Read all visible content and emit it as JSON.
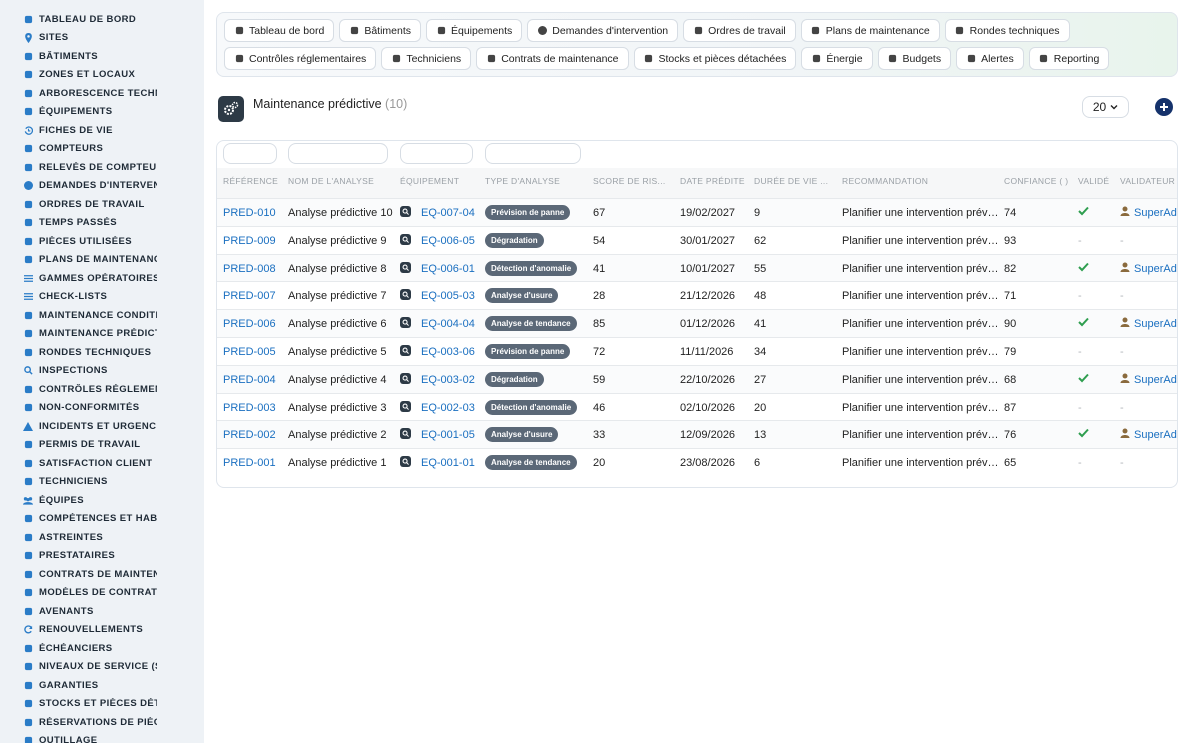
{
  "sidebar": {
    "items": [
      {
        "label": "TABLEAU DE BORD",
        "icon": "dashboard-icon"
      },
      {
        "label": "SITES",
        "icon": "pin-icon"
      },
      {
        "label": "BÂTIMENTS",
        "icon": "building-icon"
      },
      {
        "label": "ZONES ET LOCAUX",
        "icon": "zone-icon"
      },
      {
        "label": "ARBORESCENCE TECHNI",
        "icon": "tree-icon"
      },
      {
        "label": "ÉQUIPEMENTS",
        "icon": "gears-icon"
      },
      {
        "label": "FICHES DE VIE",
        "icon": "history-icon"
      },
      {
        "label": "COMPTEURS",
        "icon": "gauge-icon"
      },
      {
        "label": "RELEVÉS DE COMPTEURS",
        "icon": "reading-icon"
      },
      {
        "label": "DEMANDES D'INTERVENT",
        "icon": "question-icon"
      },
      {
        "label": "ORDRES DE TRAVAIL",
        "icon": "clipboard-icon"
      },
      {
        "label": "TEMPS PASSÉS",
        "icon": "clock-icon"
      },
      {
        "label": "PIÈCES UTILISÉES",
        "icon": "boxes-icon"
      },
      {
        "label": "PLANS DE MAINTENANCE",
        "icon": "calendar-icon"
      },
      {
        "label": "GAMMES OPÉRATOIRES",
        "icon": "list-icon"
      },
      {
        "label": "CHECK-LISTS",
        "icon": "checklist-icon"
      },
      {
        "label": "MAINTENANCE CONDITIO",
        "icon": "thermometer-icon"
      },
      {
        "label": "MAINTENANCE PRÉDICTI",
        "icon": "chart-icon"
      },
      {
        "label": "RONDES TECHNIQUES",
        "icon": "route-icon"
      },
      {
        "label": "INSPECTIONS",
        "icon": "search-icon"
      },
      {
        "label": "CONTRÔLES RÉGLEMENT",
        "icon": "clipboard-check-icon"
      },
      {
        "label": "NON-CONFORMITÉS",
        "icon": "alert-circle-icon"
      },
      {
        "label": "INCIDENTS ET URGENCES",
        "icon": "warning-icon"
      },
      {
        "label": "PERMIS DE TRAVAIL",
        "icon": "permit-icon"
      },
      {
        "label": "SATISFACTION CLIENT",
        "icon": "smile-icon"
      },
      {
        "label": "TECHNICIENS",
        "icon": "helmet-icon"
      },
      {
        "label": "ÉQUIPES",
        "icon": "team-icon"
      },
      {
        "label": "COMPÉTENCES ET HABIL",
        "icon": "certificate-icon"
      },
      {
        "label": "ASTREINTES",
        "icon": "phone-icon"
      },
      {
        "label": "PRESTATAIRES",
        "icon": "handshake-icon"
      },
      {
        "label": "CONTRATS DE MAINTENA",
        "icon": "contract-icon"
      },
      {
        "label": "MODÈLES DE CONTRATS",
        "icon": "template-icon"
      },
      {
        "label": "AVENANTS",
        "icon": "edit-file-icon"
      },
      {
        "label": "RENOUVELLEMENTS",
        "icon": "refresh-icon"
      },
      {
        "label": "ÉCHÉANCIERS",
        "icon": "calendar-days-icon"
      },
      {
        "label": "NIVEAUX DE SERVICE (SL",
        "icon": "stopwatch-icon"
      },
      {
        "label": "GARANTIES",
        "icon": "shield-icon"
      },
      {
        "label": "STOCKS ET PIÈCES DÉTA",
        "icon": "stock-icon"
      },
      {
        "label": "RÉSERVATIONS DE PIÈCE",
        "icon": "bookmark-icon"
      },
      {
        "label": "OUTILLAGE",
        "icon": "tools-icon"
      }
    ]
  },
  "topnav": {
    "row1": [
      {
        "label": "Tableau de bord",
        "icon": "dashboard-icon"
      },
      {
        "label": "Bâtiments",
        "icon": "building-icon"
      },
      {
        "label": "Équipements",
        "icon": "gears-icon"
      },
      {
        "label": "Demandes d'intervention",
        "icon": "question-icon"
      },
      {
        "label": "Ordres de travail",
        "icon": "clipboard-icon"
      },
      {
        "label": "Plans de maintenance",
        "icon": "calendar-icon"
      },
      {
        "label": "Rondes techniques",
        "icon": "route-icon"
      }
    ],
    "row2": [
      {
        "label": "Contrôles réglementaires",
        "icon": "clipboard-check-icon"
      },
      {
        "label": "Techniciens",
        "icon": "helmet-icon"
      },
      {
        "label": "Contrats de maintenance",
        "icon": "contract-icon"
      },
      {
        "label": "Stocks et pièces détachées",
        "icon": "stock-icon"
      },
      {
        "label": "Énergie",
        "icon": "bolt-icon"
      },
      {
        "label": "Budgets",
        "icon": "money-icon"
      },
      {
        "label": "Alertes",
        "icon": "bell-icon"
      },
      {
        "label": "Reporting",
        "icon": "pie-icon"
      }
    ]
  },
  "page": {
    "title": "Maintenance prédictive",
    "count": "(10)",
    "per_page": "20"
  },
  "table": {
    "columns": [
      "RÉFÉRENCE",
      "NOM DE L'ANALYSE",
      "ÉQUIPEMENT",
      "TYPE D'ANALYSE",
      "SCORE DE RIS...",
      "DATE PRÉDITE",
      "DURÉE DE VIE ...",
      "RECOMMANDATION",
      "CONFIANCE ( )",
      "VALIDÉ",
      "VALIDATEUR"
    ],
    "rows": [
      {
        "ref": "PRED-010",
        "name": "Analyse prédictive 10",
        "equip": "EQ-007-04",
        "type": "Prévision de panne",
        "score": "67",
        "date": "19/02/2027",
        "life": "9",
        "reco": "Planifier une intervention prév…",
        "conf": "74",
        "validated": true,
        "validator": "SuperAdmin"
      },
      {
        "ref": "PRED-009",
        "name": "Analyse prédictive 9",
        "equip": "EQ-006-05",
        "type": "Dégradation",
        "score": "54",
        "date": "30/01/2027",
        "life": "62",
        "reco": "Planifier une intervention prév…",
        "conf": "93",
        "validated": false,
        "validator": ""
      },
      {
        "ref": "PRED-008",
        "name": "Analyse prédictive 8",
        "equip": "EQ-006-01",
        "type": "Détection d'anomalie",
        "score": "41",
        "date": "10/01/2027",
        "life": "55",
        "reco": "Planifier une intervention prév…",
        "conf": "82",
        "validated": true,
        "validator": "SuperAdmin"
      },
      {
        "ref": "PRED-007",
        "name": "Analyse prédictive 7",
        "equip": "EQ-005-03",
        "type": "Analyse d'usure",
        "score": "28",
        "date": "21/12/2026",
        "life": "48",
        "reco": "Planifier une intervention prév…",
        "conf": "71",
        "validated": false,
        "validator": ""
      },
      {
        "ref": "PRED-006",
        "name": "Analyse prédictive 6",
        "equip": "EQ-004-04",
        "type": "Analyse de tendance",
        "score": "85",
        "date": "01/12/2026",
        "life": "41",
        "reco": "Planifier une intervention prév…",
        "conf": "90",
        "validated": true,
        "validator": "SuperAdmin"
      },
      {
        "ref": "PRED-005",
        "name": "Analyse prédictive 5",
        "equip": "EQ-003-06",
        "type": "Prévision de panne",
        "score": "72",
        "date": "11/11/2026",
        "life": "34",
        "reco": "Planifier une intervention prév…",
        "conf": "79",
        "validated": false,
        "validator": ""
      },
      {
        "ref": "PRED-004",
        "name": "Analyse prédictive 4",
        "equip": "EQ-003-02",
        "type": "Dégradation",
        "score": "59",
        "date": "22/10/2026",
        "life": "27",
        "reco": "Planifier une intervention prév…",
        "conf": "68",
        "validated": true,
        "validator": "SuperAdmin"
      },
      {
        "ref": "PRED-003",
        "name": "Analyse prédictive 3",
        "equip": "EQ-002-03",
        "type": "Détection d'anomalie",
        "score": "46",
        "date": "02/10/2026",
        "life": "20",
        "reco": "Planifier une intervention prév…",
        "conf": "87",
        "validated": false,
        "validator": ""
      },
      {
        "ref": "PRED-002",
        "name": "Analyse prédictive 2",
        "equip": "EQ-001-05",
        "type": "Analyse d'usure",
        "score": "33",
        "date": "12/09/2026",
        "life": "13",
        "reco": "Planifier une intervention prév…",
        "conf": "76",
        "validated": true,
        "validator": "SuperAdmin"
      },
      {
        "ref": "PRED-001",
        "name": "Analyse prédictive 1",
        "equip": "EQ-001-01",
        "type": "Analyse de tendance",
        "score": "20",
        "date": "23/08/2026",
        "life": "6",
        "reco": "Planifier une intervention prév…",
        "conf": "65",
        "validated": false,
        "validator": ""
      }
    ],
    "empty_mark": "-"
  },
  "colors": {
    "accent": "#1a6fc0",
    "badge": "#5b6877",
    "check": "#2e9e4f",
    "primary": "#15326b"
  }
}
